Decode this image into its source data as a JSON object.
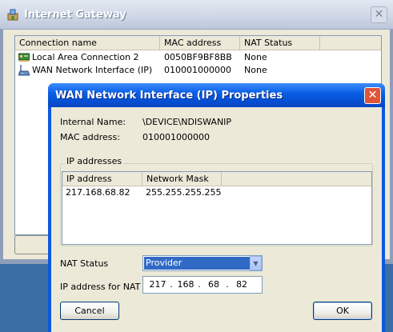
{
  "bg_window": {
    "title": "Internet Gateway",
    "close_glyph": "✕",
    "columns": [
      "Connection name",
      "MAC address",
      "NAT Status"
    ],
    "rows": [
      {
        "name": "Local Area Connection 2",
        "mac": "0050BF9BF8BB",
        "nat": "None",
        "icon": "network-card-icon"
      },
      {
        "name": "WAN Network Interface (IP)",
        "mac": "010001000000",
        "nat": "None",
        "icon": "modem-icon"
      }
    ]
  },
  "dialog": {
    "title": "WAN Network Interface (IP) Properties",
    "close_glyph": "✕",
    "internal_name_label": "Internal Name:",
    "internal_name_value": "\\DEVICE\\NDISWANIP",
    "mac_label": "MAC address:",
    "mac_value": "010001000000",
    "ip_group_title": "IP addresses",
    "ip_columns": [
      "IP address",
      "Network Mask"
    ],
    "ip_rows": [
      {
        "ip": "217.168.68.82",
        "mask": "255.255.255.255"
      }
    ],
    "nat_status_label": "NAT Status",
    "nat_status_value": "Provider",
    "nat_ip_label": "IP address for NAT",
    "nat_ip": [
      "217",
      "168",
      "68",
      "82"
    ],
    "cancel_label": "Cancel",
    "ok_label": "OK"
  },
  "colors": {
    "title_active": "#0a5fe6",
    "close_red": "#e0543a",
    "selection": "#316ac5"
  }
}
